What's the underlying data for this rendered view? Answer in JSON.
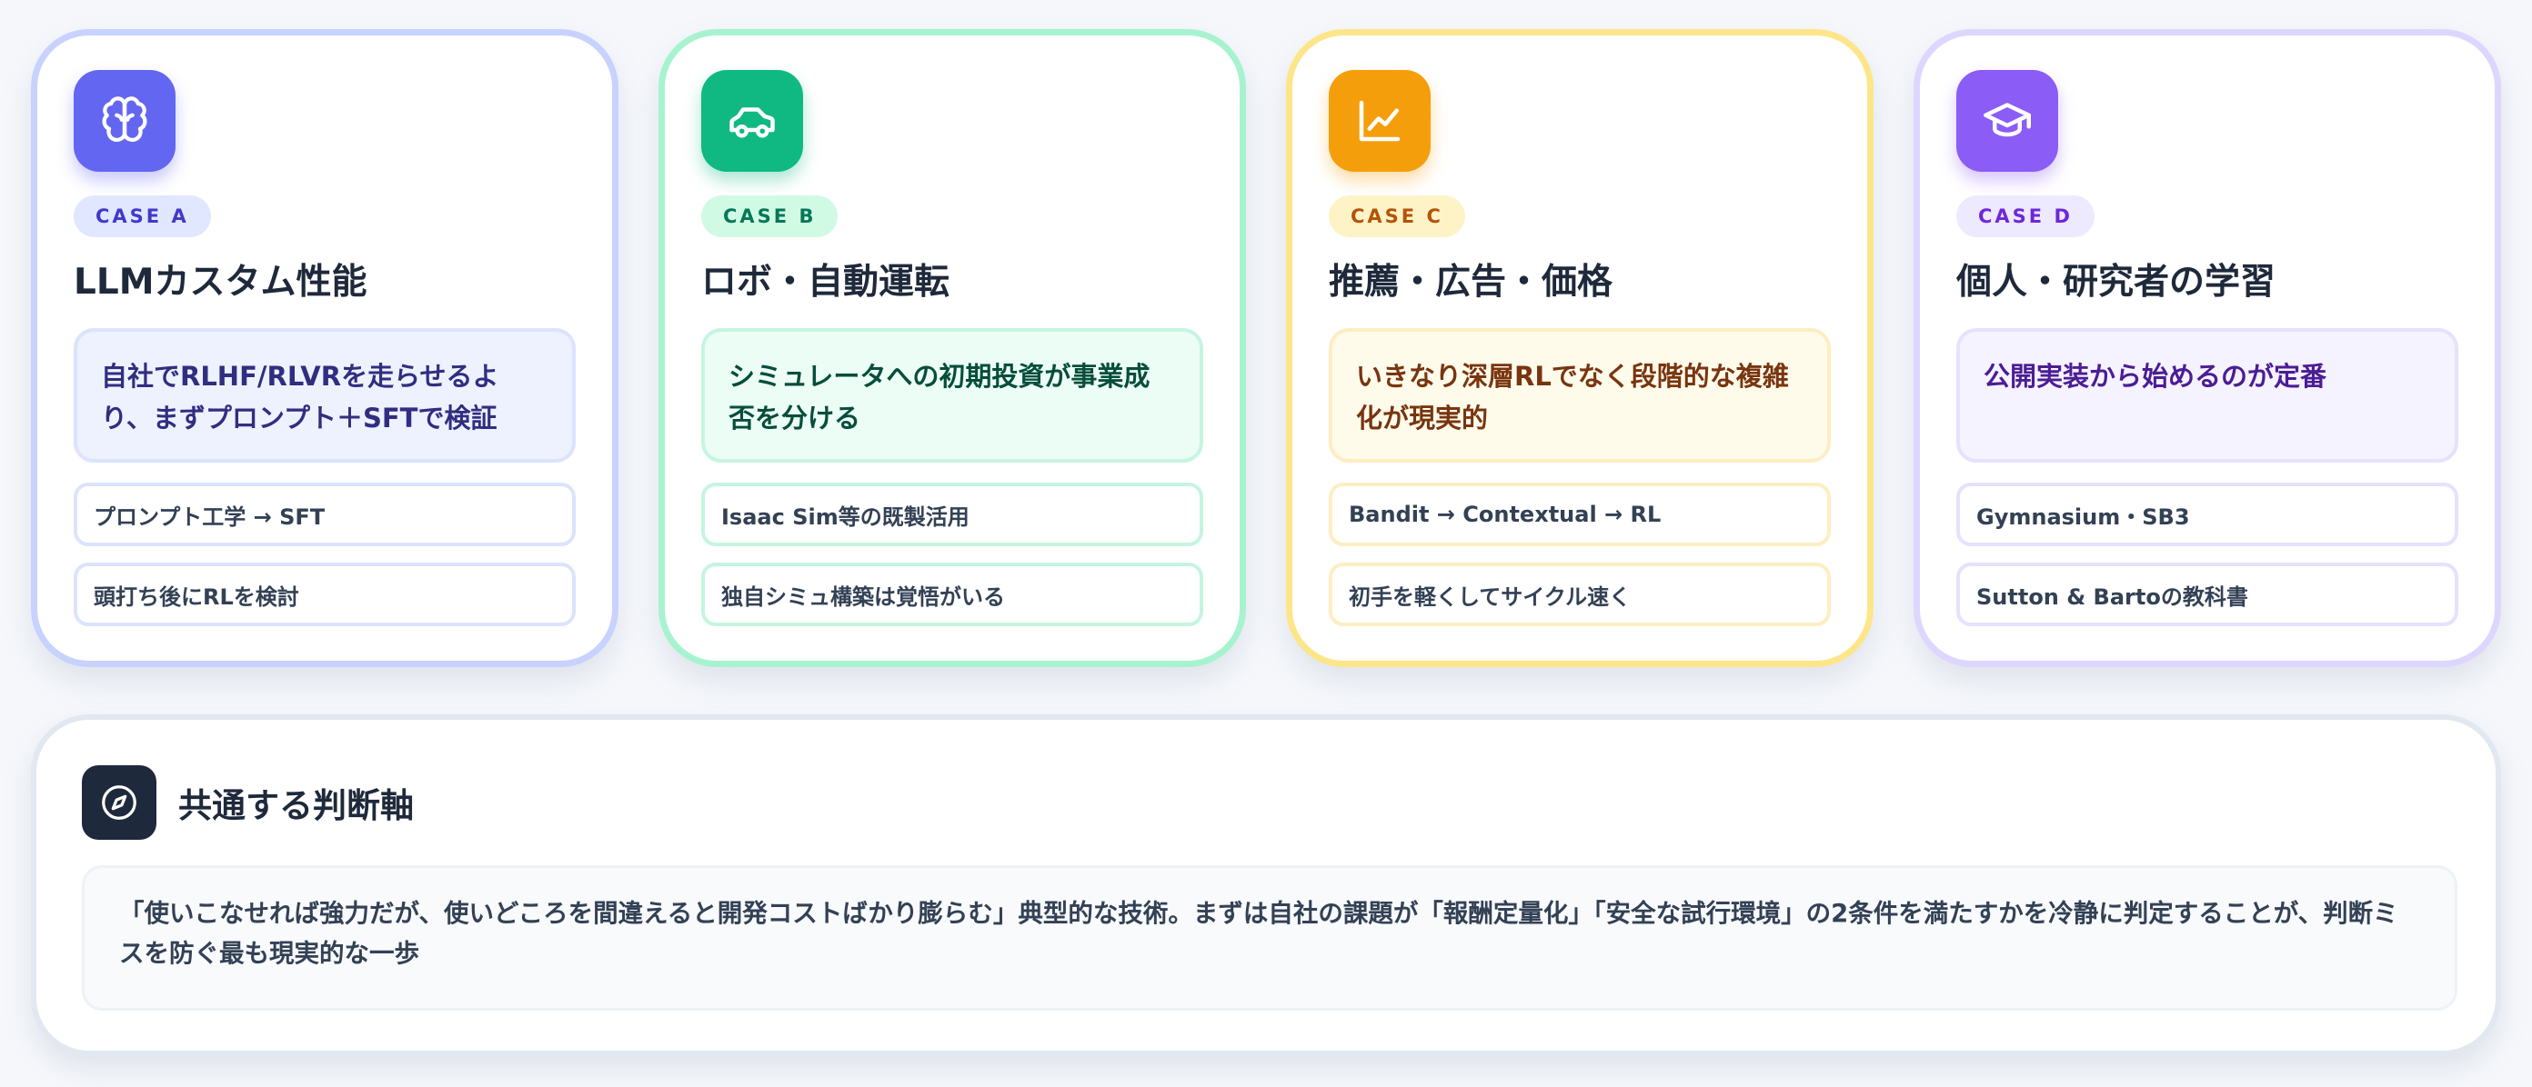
{
  "cards": [
    {
      "id": "a",
      "icon": "brain-icon",
      "badge": "CASE A",
      "title": "LLMカスタム性能",
      "highlight": "自社でRLHF/RLVRを走らせるより、まずプロンプト＋SFTで検証",
      "items": [
        "プロンプト工学 → SFT",
        "頭打ち後にRLを検討"
      ],
      "colors": {
        "accent": "#6366f1",
        "border": "#c7d2fe"
      }
    },
    {
      "id": "b",
      "icon": "car-icon",
      "badge": "CASE B",
      "title": "ロボ・自動運転",
      "highlight": "シミュレータへの初期投資が事業成否を分ける",
      "items": [
        "Isaac Sim等の既製活用",
        "独自シミュ構築は覚悟がいる"
      ],
      "colors": {
        "accent": "#10b981",
        "border": "#a7f3d0"
      }
    },
    {
      "id": "c",
      "icon": "line-chart-icon",
      "badge": "CASE C",
      "title": "推薦・広告・価格",
      "highlight": "いきなり深層RLでなく段階的な複雑化が現実的",
      "items": [
        "Bandit → Contextual → RL",
        "初手を軽くしてサイクル速く"
      ],
      "colors": {
        "accent": "#f59e0b",
        "border": "#fde68a"
      }
    },
    {
      "id": "d",
      "icon": "graduation-cap-icon",
      "badge": "CASE D",
      "title": "個人・研究者の学習",
      "highlight": "公開実装から始めるのが定番",
      "items": [
        "Gymnasium・SB3",
        "Sutton & Bartoの教科書"
      ],
      "colors": {
        "accent": "#8b5cf6",
        "border": "#ddd6fe"
      }
    }
  ],
  "summary": {
    "icon": "compass-icon",
    "title": "共通する判断軸",
    "body": "「使いこなせれば強力だが、使いどころを間違えると開発コストばかり膨らむ」典型的な技術。まずは自社の課題が「報酬定量化」「安全な試行環境」の2条件を満たすかを冷静に判定することが、判断ミスを防ぐ最も現実的な一歩"
  }
}
